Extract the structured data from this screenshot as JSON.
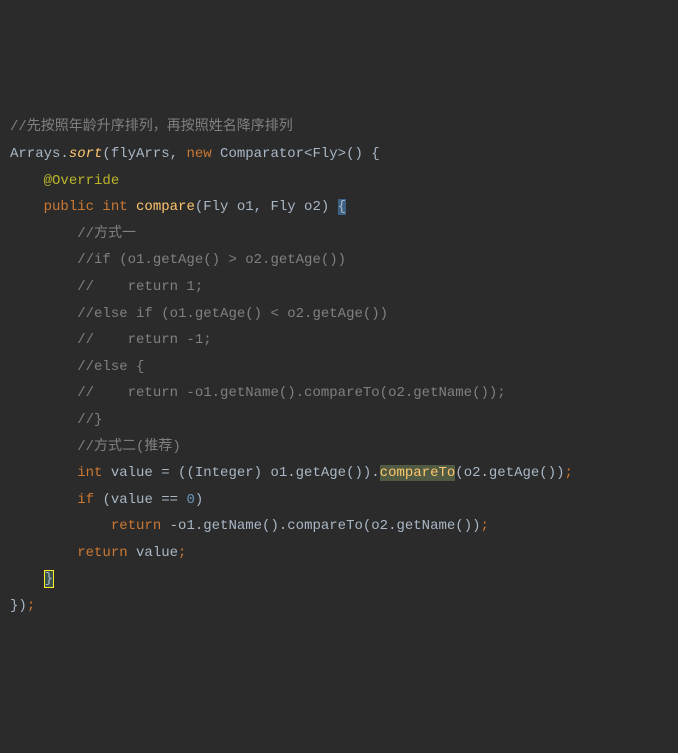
{
  "lines": {
    "l1": "//先按照年龄升序排列，再按照姓名降序排列",
    "l2_a": "Arrays.",
    "l2_sort": "sort",
    "l2_b": "(flyArrs, ",
    "l2_new": "new ",
    "l2_c": "Comparator<Fly>() {",
    "l3_ann": "@Override",
    "l4_pub": "public ",
    "l4_int": "int ",
    "l4_cmp": "compare",
    "l4_p": "(Fly o1, Fly o2) ",
    "l4_brace": "{",
    "l5": "//方式一",
    "l6": "//if (o1.getAge() > o2.getAge())",
    "l7": "//    return 1;",
    "l8": "//else if (o1.getAge() < o2.getAge())",
    "l9": "//    return -1;",
    "l10": "//else {",
    "l11": "//    return -o1.getName().compareTo(o2.getName());",
    "l12": "//}",
    "l13": "//方式二(推荐)",
    "l14_int": "int ",
    "l14_a": "value = ((Integer) o1.getAge()).",
    "l14_ct": "compareTo",
    "l14_b": "(o2.getAge())",
    "l14_sc": ";",
    "l15_if": "if ",
    "l15_a": "(value == ",
    "l15_n": "0",
    "l15_b": ")",
    "l16_ret": "return ",
    "l16_a": "-o1.getName().compareTo(o2.getName())",
    "l16_sc": ";",
    "l17_ret": "return ",
    "l17_a": "value",
    "l17_sc": ";",
    "l18_brace": "}",
    "l19_a": "})",
    "l19_sc": ";"
  },
  "indent": {
    "i1": "    ",
    "i2": "        ",
    "i3": "            "
  }
}
